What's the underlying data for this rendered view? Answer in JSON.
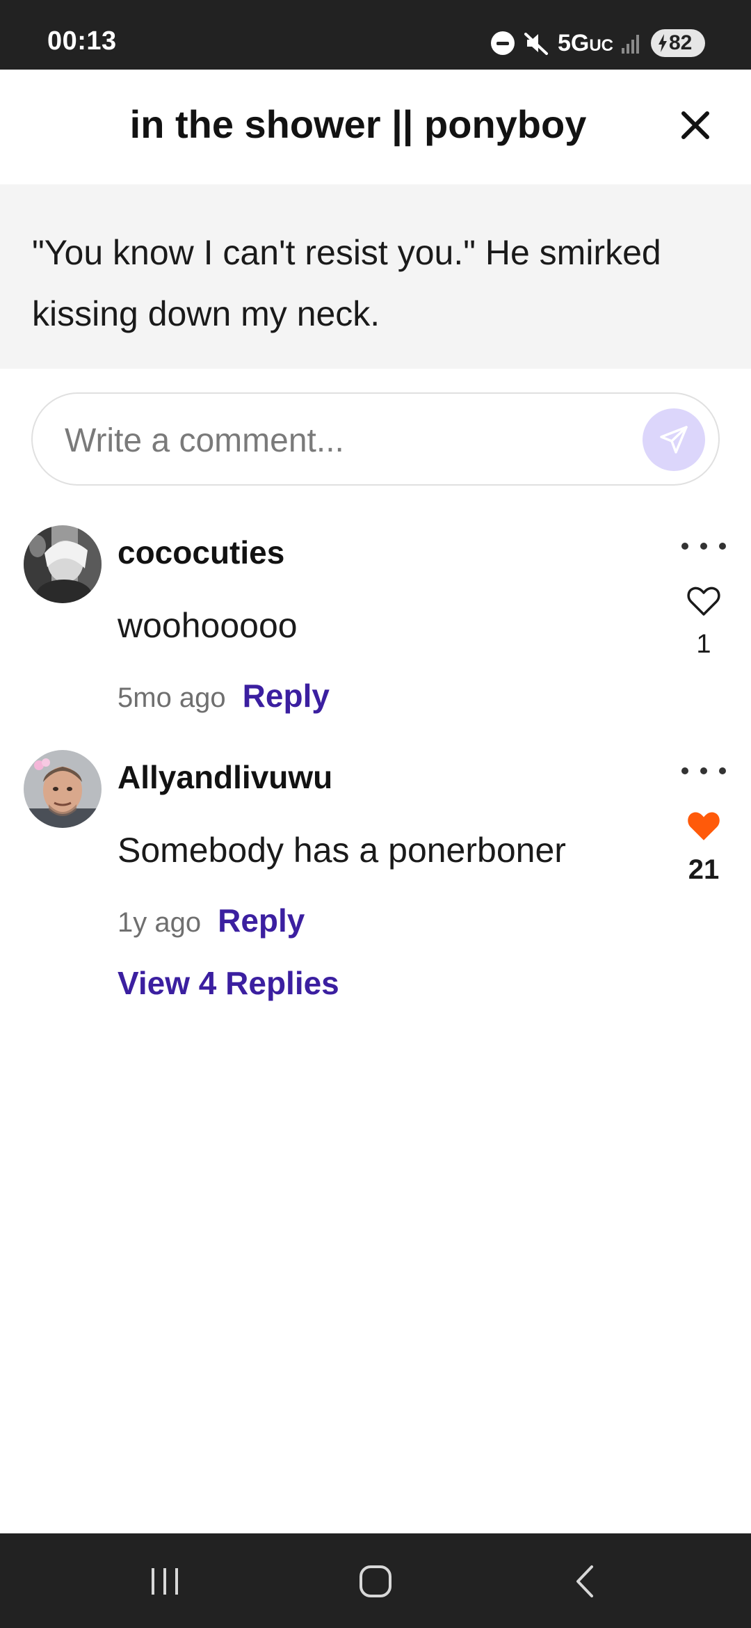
{
  "status_bar": {
    "time": "00:13",
    "network": "5G",
    "network_suffix": "UC",
    "battery": "82",
    "icons": [
      "do-not-disturb-icon",
      "mute-icon",
      "signal-icon",
      "charging-bolt-icon"
    ]
  },
  "header": {
    "title": "in the shower || ponyboy",
    "close_icon": "close-icon"
  },
  "quote": {
    "text": "\"You know I can't resist you.\" He smirked kissing down my neck."
  },
  "comment_box": {
    "placeholder": "Write a comment...",
    "value": "",
    "send_icon": "send-icon"
  },
  "comments": [
    {
      "username": "cococuties",
      "text": "woohooooo",
      "time": "5mo ago",
      "reply_label": "Reply",
      "likes": "1",
      "liked": false
    },
    {
      "username": "Allyandlivuwu",
      "text": "Somebody has a ponerboner",
      "time": "1y ago",
      "reply_label": "Reply",
      "likes": "21",
      "liked": true,
      "view_replies_label": "View 4 Replies"
    }
  ],
  "colors": {
    "accent": "#3b1fa0",
    "like_active": "#ff5a0a",
    "send_button": "#dcd6fb",
    "quote_background": "#f4f4f4",
    "system_bar": "#222222"
  },
  "nav_bar": {
    "icons": [
      "recent-apps-icon",
      "home-icon",
      "back-icon"
    ]
  }
}
